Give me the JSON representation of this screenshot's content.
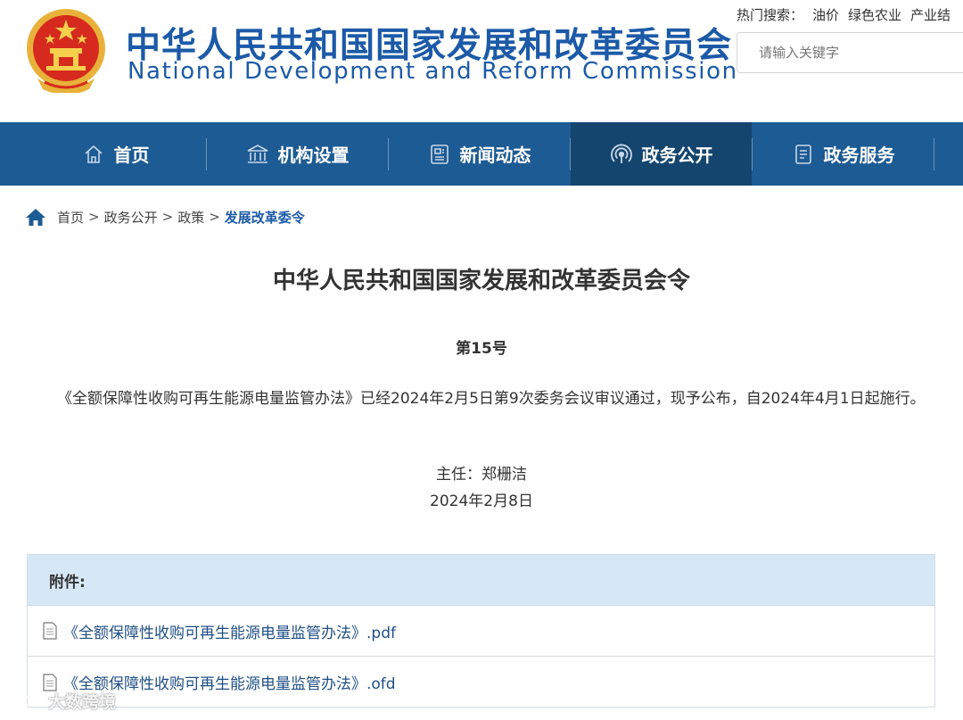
{
  "header": {
    "title_cn": "中华人民共和国国家发展和改革委员会",
    "title_en": "National Development and Reform Commission",
    "hot_label": "热门搜索：",
    "hot_items": [
      "油价",
      "绿色农业",
      "产业结"
    ],
    "search_placeholder": "请输入关键字",
    "brand_color": "#1c5aa8"
  },
  "nav": {
    "items": [
      {
        "label": "首页",
        "icon": "home-icon"
      },
      {
        "label": "机构设置",
        "icon": "building-icon"
      },
      {
        "label": "新闻动态",
        "icon": "newspaper-icon"
      },
      {
        "label": "政务公开",
        "icon": "broadcast-icon",
        "active": true
      },
      {
        "label": "政务服务",
        "icon": "document-icon"
      }
    ],
    "bg_color": "#1d5b94",
    "active_color": "#14456f"
  },
  "breadcrumb": {
    "items": [
      "首页",
      "政务公开",
      "政策"
    ],
    "separator": ">",
    "current": "发展改革委令"
  },
  "article": {
    "title": "中华人民共和国国家发展和改革委员会令",
    "number": "第15号",
    "body": "《全额保障性收购可再生能源电量监管办法》已经2024年2月5日第9次委务会议审议通过，现予公布，自2024年4月1日起施行。",
    "signer": "主任：郑栅洁",
    "date": "2024年2月8日"
  },
  "attachments": {
    "heading": "附件:",
    "files": [
      {
        "name": "《全额保障性收购可再生能源电量监管办法》.pdf",
        "icon": "file-icon"
      },
      {
        "name": "《全额保障性收购可再生能源电量监管办法》.ofd",
        "icon": "file-icon"
      }
    ]
  },
  "watermark": {
    "text": "大数跨境"
  }
}
